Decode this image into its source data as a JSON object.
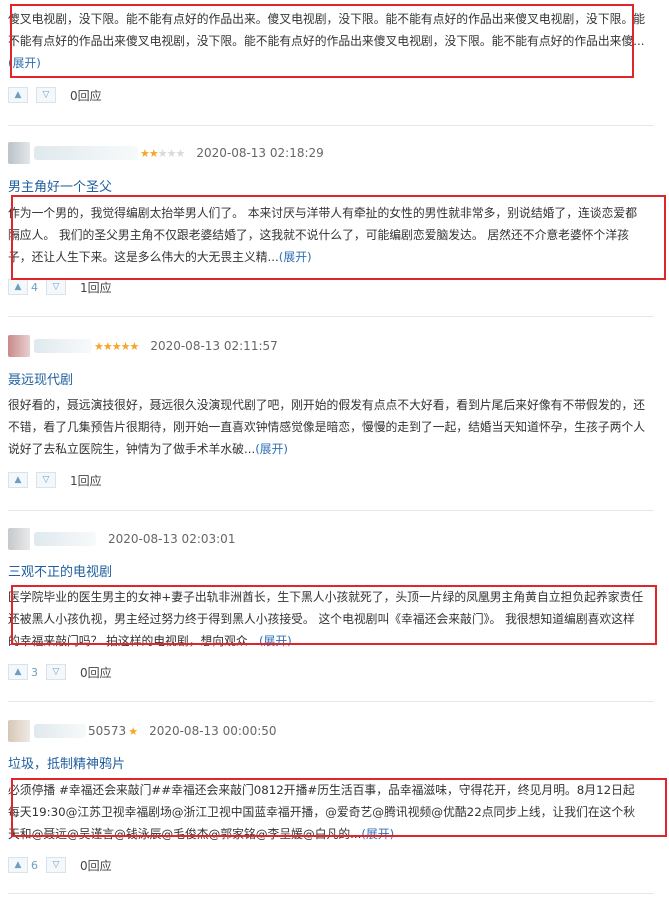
{
  "reviews": [
    {
      "body_text": "傻叉电视剧，没下限。能不能有点好的作品出来。傻叉电视剧，没下限。能不能有点好的作品出来傻叉电视剧，没下限。能不能有点好的作品出来傻叉电视剧，没下限。能不能有点好的作品出来傻叉电视剧，没下限。能不能有点好的作品出来傻...",
      "expand": "(展开)",
      "up_count": "",
      "replies": "0回应"
    },
    {
      "date": "2020-08-13 02:18:29",
      "rating_stars": 2,
      "title": "男主角好一个圣父",
      "body_text": "作为一个男的，我觉得编剧太抬举男人们了。 本来讨厌与洋带人有牵扯的女性的男性就非常多，别说结婚了，连谈恋爱都隔应人。 我们的圣父男主角不仅跟老婆结婚了，这我就不说什么了，可能编剧恋爱脑发达。 居然还不介意老婆怀个洋孩子，还让人生下来。这是多么伟大的大无畏主义精...",
      "expand": "(展开)",
      "up_count": "4",
      "replies": "1回应"
    },
    {
      "date": "2020-08-13 02:11:57",
      "rating_stars": 5,
      "title": "聂远现代剧",
      "body_text": "很好看的，聂远演技很好，聂远很久没演现代剧了吧，刚开始的假发有点点不大好看，看到片尾后来好像有不带假发的，还不错，看了几集预告片很期待，刚开始一直喜欢钟情感觉像是暗恋，慢慢的走到了一起，结婚当天知道怀孕，生孩子两个人说好了去私立医院生，钟情为了做手术羊水破...",
      "expand": "(展开)",
      "up_count": "",
      "replies": "1回应"
    },
    {
      "date": "2020-08-13 02:03:01",
      "rating_stars": 0,
      "title": "三观不正的电视剧",
      "body_text": "医学院毕业的医生男主的女神+妻子出轨非洲酋长，生下黑人小孩就死了，头顶一片绿的凤凰男主角黄自立担负起养家责任还被黑人小孩仇视，男主经过努力终于得到黑人小孩接受。 这个电视剧叫《幸福还会来敲门》。 我很想知道编剧喜欢这样的幸福来敲门吗？ 拍这样的电视剧，想向观众...",
      "expand": "(展开)",
      "up_count": "3",
      "replies": "0回应"
    },
    {
      "username_partial": "50573",
      "date": "2020-08-13 00:00:50",
      "rating_stars": 1,
      "title": "垃圾，抵制精神鸦片",
      "body_text": "必须停播 #幸福还会来敲门##幸福还会来敲门0812开播#历生活百事，品幸福滋味，守得花开，终见月明。8月12日起每天19:30@江苏卫视幸福剧场@浙江卫视中国蓝幸福开播，@爱奇艺@腾讯视频@优酷22点同步上线，让我们在这个秋天和@聂远@吴谨言@钱泳辰@毛俊杰@郭家铭@李呈媛@白凡的...",
      "expand": "(展开)",
      "up_count": "6",
      "replies": "0回应"
    }
  ],
  "colors": {
    "link_blue": "#1f5f9e",
    "star_gold": "#f5a623",
    "highlight_red": "#e0262b"
  },
  "icons": {
    "upvote": "▲",
    "downvote": "▽",
    "star_on": "★",
    "star_off": "★"
  }
}
